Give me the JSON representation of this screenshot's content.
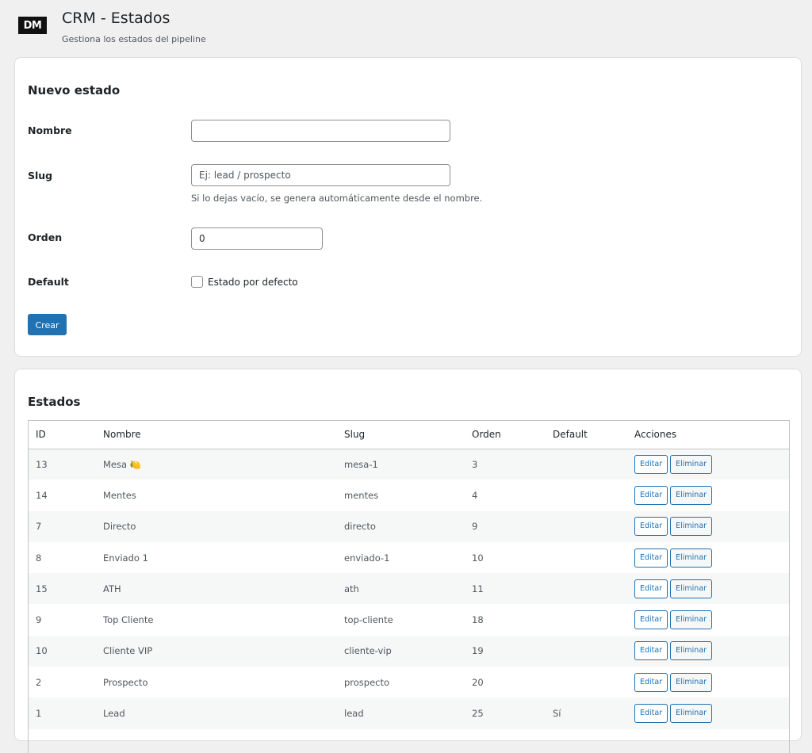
{
  "header": {
    "logo_text": "DM",
    "title": "CRM - Estados",
    "subtitle": "Gestiona los estados del pipeline"
  },
  "form": {
    "title": "Nuevo estado",
    "nombre_label": "Nombre",
    "nombre_value": "",
    "slug_label": "Slug",
    "slug_placeholder": "Ej: lead / prospecto",
    "slug_hint": "Si lo dejas vacío, se genera automáticamente desde el nombre.",
    "orden_label": "Orden",
    "orden_value": "0",
    "default_label": "Default",
    "default_checkbox_label": "Estado por defecto",
    "default_checked": false,
    "submit_label": "Crear"
  },
  "table": {
    "title": "Estados",
    "columns": [
      "ID",
      "Nombre",
      "Slug",
      "Orden",
      "Default",
      "Acciones"
    ],
    "edit_label": "Editar",
    "delete_label": "Eliminar",
    "rows": [
      {
        "id": "13",
        "nombre": "Mesa 🍋",
        "slug": "mesa-1",
        "orden": "3",
        "default": ""
      },
      {
        "id": "14",
        "nombre": "Mentes",
        "slug": "mentes",
        "orden": "4",
        "default": ""
      },
      {
        "id": "7",
        "nombre": "Directo",
        "slug": "directo",
        "orden": "9",
        "default": ""
      },
      {
        "id": "8",
        "nombre": "Enviado 1",
        "slug": "enviado-1",
        "orden": "10",
        "default": ""
      },
      {
        "id": "15",
        "nombre": "ATH",
        "slug": "ath",
        "orden": "11",
        "default": ""
      },
      {
        "id": "9",
        "nombre": "Top Cliente",
        "slug": "top-cliente",
        "orden": "18",
        "default": ""
      },
      {
        "id": "10",
        "nombre": "Cliente VIP",
        "slug": "cliente-vip",
        "orden": "19",
        "default": ""
      },
      {
        "id": "2",
        "nombre": "Prospecto",
        "slug": "prospecto",
        "orden": "20",
        "default": ""
      },
      {
        "id": "1",
        "nombre": "Lead",
        "slug": "lead",
        "orden": "25",
        "default": "Sí"
      }
    ]
  },
  "colors": {
    "primary": "#2271b1",
    "background": "#f0f0f1",
    "row_alt": "#f6f7f7"
  }
}
